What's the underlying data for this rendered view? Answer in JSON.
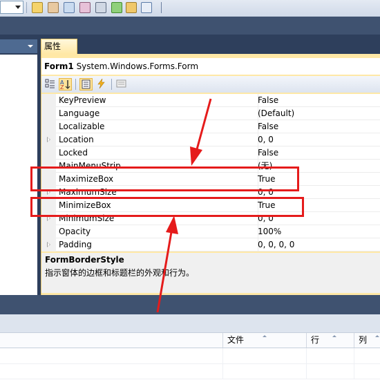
{
  "properties_panel": {
    "tab_label": "属性",
    "object_name": "Form1",
    "object_type": "System.Windows.Forms.Form",
    "rows": [
      {
        "name": "KeyPreview",
        "value": "False",
        "expandable": false
      },
      {
        "name": "Language",
        "value": "(Default)",
        "expandable": false
      },
      {
        "name": "Localizable",
        "value": "False",
        "expandable": false
      },
      {
        "name": "Location",
        "value": "0, 0",
        "expandable": true
      },
      {
        "name": "Locked",
        "value": "False",
        "expandable": false
      },
      {
        "name": "MainMenuStrip",
        "value": "(无)",
        "expandable": false
      },
      {
        "name": "MaximizeBox",
        "value": "True",
        "expandable": false
      },
      {
        "name": "MaximumSize",
        "value": "0, 0",
        "expandable": true
      },
      {
        "name": "MinimizeBox",
        "value": "True",
        "expandable": false
      },
      {
        "name": "MinimumSize",
        "value": "0, 0",
        "expandable": true
      },
      {
        "name": "Opacity",
        "value": "100%",
        "expandable": false
      },
      {
        "name": "Padding",
        "value": "0, 0, 0, 0",
        "expandable": true
      }
    ],
    "description": {
      "title": "FormBorderStyle",
      "text": "指示窗体的边框和标题栏的外观和行为。"
    }
  },
  "error_list": {
    "columns": [
      "文件",
      "行",
      "列"
    ]
  },
  "toolbar_icons": [
    "find-in-files-icon",
    "properties-icon",
    "object-browser-icon",
    "toolbox-icon",
    "tools-icon",
    "start-page-icon",
    "class-view-icon",
    "command-window-icon"
  ],
  "colors": {
    "annotation_red": "#e51b1b",
    "panel_accent": "#ffe8a6",
    "dark_band": "#3f5270"
  }
}
